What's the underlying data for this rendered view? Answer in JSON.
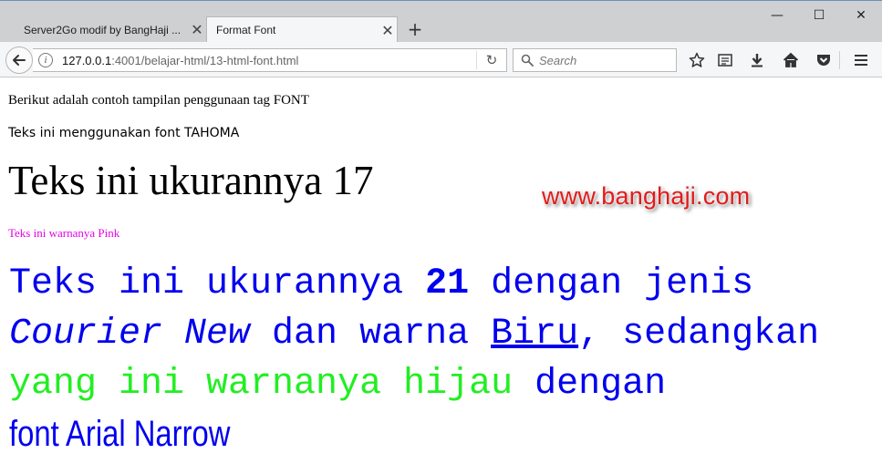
{
  "browser": {
    "tabs": [
      {
        "title": "Server2Go modif by BangHaji ...",
        "active": false
      },
      {
        "title": "Format Font",
        "active": true
      }
    ],
    "new_tab_symbol": "+",
    "window_controls": {
      "minimize": "—",
      "maximize": "☐",
      "close": "✕"
    },
    "url": {
      "host": "127.0.0.1",
      "rest": ":4001/belajar-html/13-html-font.html"
    },
    "search_placeholder": "Search"
  },
  "page": {
    "line1": "Berikut adalah contoh tampilan penggunaan tag FONT",
    "line2": "Teks ini menggunakan font TAHOMA",
    "line3": "Teks ini ukurannya 17",
    "line4": "Teks ini warnanya Pink",
    "paragraph": {
      "p1": "Teks ini ukurannya ",
      "p2_bold": "21",
      "p3": " dengan jenis ",
      "p4_italic": "Courier New",
      "p5": " dan warna ",
      "p6_underline": "Biru",
      "p7": ", sedangkan ",
      "p8_green": "yang ini warnanya hijau",
      "p9": " dengan ",
      "p10_narrow": "font Arial Narrow"
    },
    "watermark": "www.banghaji.com"
  },
  "colors": {
    "pink": "#e600e6",
    "blue": "#0000ee",
    "green": "#22ee22",
    "watermark": "#e21b1b"
  }
}
